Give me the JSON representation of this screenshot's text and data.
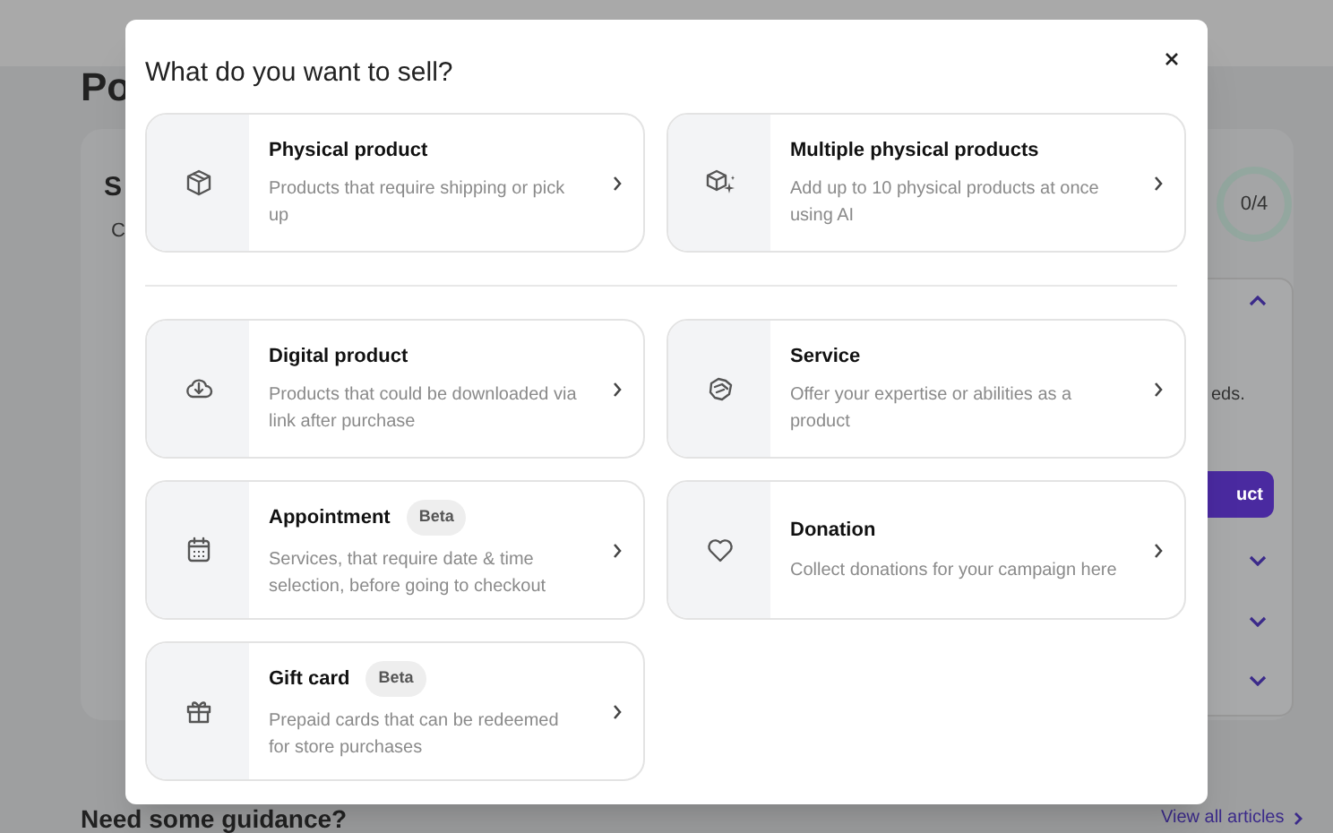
{
  "background": {
    "heading": "Po",
    "section_title": "S",
    "section_subtitle": "C",
    "progress": "0/4",
    "text_fragment": "eds.",
    "button": "uct",
    "accordion": [
      {
        "expanded": true
      },
      {
        "expanded": false
      },
      {
        "expanded": false
      },
      {
        "expanded": false
      }
    ],
    "guidance_title": "Need some guidance?",
    "link": "View all articles"
  },
  "modal": {
    "title": "What do you want to sell?",
    "groups": [
      [
        {
          "title": "Physical product",
          "description": "Products that require shipping or pick up"
        },
        {
          "title": "Multiple physical products",
          "description": "Add up to 10 physical products at once using AI"
        }
      ],
      [
        {
          "title": "Digital product",
          "description": "Products that could be downloaded via link after purchase"
        },
        {
          "title": "Service",
          "description": "Offer your expertise or abilities as a product"
        },
        {
          "title": "Appointment",
          "badge": "Beta",
          "description": "Services, that require date & time selection, before going to checkout"
        },
        {
          "title": "Donation",
          "description": "Collect donations for your campaign here"
        },
        {
          "title": "Gift card",
          "badge": "Beta",
          "description": "Prepaid cards that can be redeemed for store purchases"
        }
      ]
    ]
  }
}
